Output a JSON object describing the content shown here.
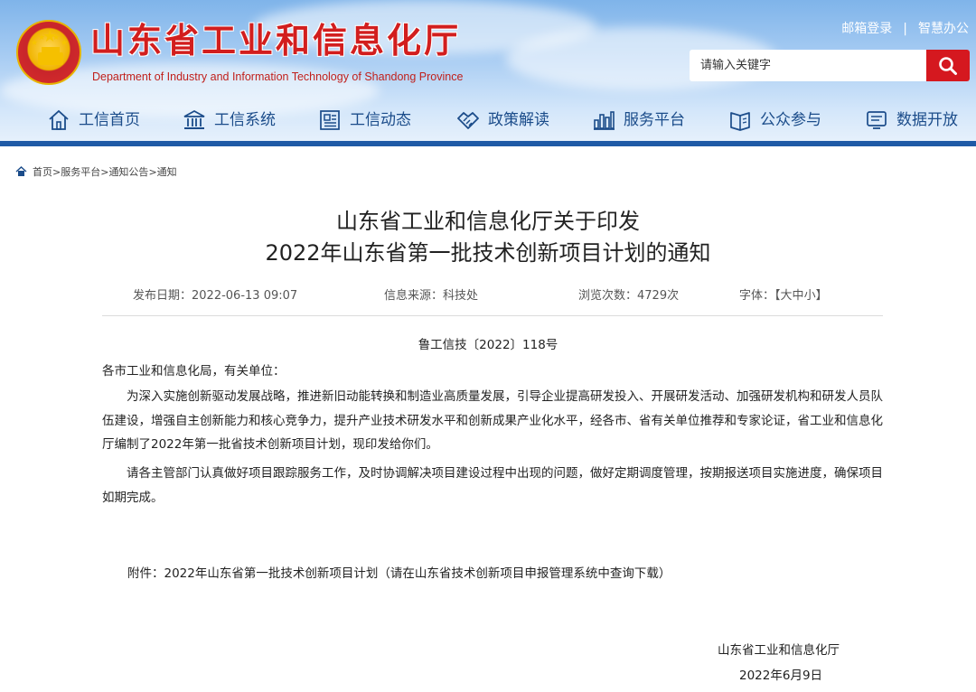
{
  "header": {
    "site_title": "山东省工业和信息化厅",
    "site_subtitle": "Department of Industry and Information Technology of Shandong Province",
    "top_links": {
      "mail_login": "邮箱登录",
      "separator": "|",
      "smart_office": "智慧办公"
    },
    "search": {
      "placeholder": "请输入关键字",
      "button_icon": "search-icon"
    },
    "nav": [
      {
        "label": "工信首页",
        "icon": "home-icon"
      },
      {
        "label": "工信系统",
        "icon": "building-icon"
      },
      {
        "label": "工信动态",
        "icon": "news-icon"
      },
      {
        "label": "政策解读",
        "icon": "handshake-icon"
      },
      {
        "label": "服务平台",
        "icon": "platform-icon"
      },
      {
        "label": "公众参与",
        "icon": "book-icon"
      },
      {
        "label": "数据开放",
        "icon": "data-icon"
      }
    ],
    "colors": {
      "accent_red": "#d5181f",
      "nav_text": "#1b4c8a",
      "band_blue": "#1f5aa6"
    }
  },
  "breadcrumb": [
    "首页",
    "服务平台",
    "通知公告",
    "通知"
  ],
  "breadcrumb_sep": ">",
  "article": {
    "title_line1": "山东省工业和信息化厅关于印发",
    "title_line2": "2022年山东省第一批技术创新项目计划的通知",
    "meta": {
      "publish_label": "发布日期：",
      "publish_value": "2022-06-13 09:07",
      "source_label": "信息来源：",
      "source_value": "科技处",
      "views_label": "浏览次数：",
      "views_value": "4729次",
      "font_label": "字体：",
      "font_open": "【",
      "font_large": "大",
      "font_medium": "中",
      "font_small": "小",
      "font_close": "】"
    },
    "doc_number": "鲁工信技〔2022〕118号",
    "salutation": "各市工业和信息化局，有关单位：",
    "paragraph1": "为深入实施创新驱动发展战略，推进新旧动能转换和制造业高质量发展，引导企业提高研发投入、开展研发活动、加强研发机构和研发人员队伍建设，增强自主创新能力和核心竞争力，提升产业技术研发水平和创新成果产业化水平，经各市、省有关单位推荐和专家论证，省工业和信息化厅编制了2022年第一批省技术创新项目计划，现印发给你们。",
    "paragraph2": "请各主管部门认真做好项目跟踪服务工作，及时协调解决项目建设过程中出现的问题，做好定期调度管理，按期报送项目实施进度，确保项目如期完成。",
    "attachment": "附件：2022年山东省第一批技术创新项目计划（请在山东省技术创新项目申报管理系统中查询下载）",
    "signature_org": "山东省工业和信息化厅",
    "signature_date": "2022年6月9日"
  }
}
